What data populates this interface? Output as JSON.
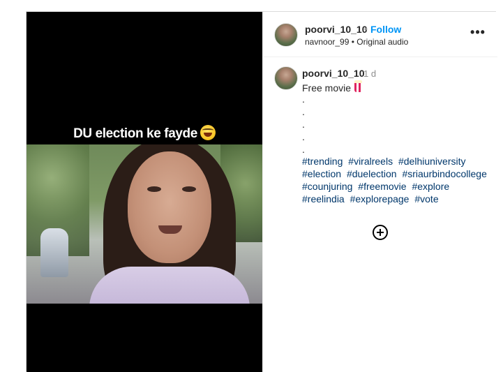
{
  "media": {
    "overlay_text": "DU election ke fayde"
  },
  "header": {
    "username": "poorvi_10_10",
    "separator": "•",
    "follow_label": "Follow",
    "audio_line": "navnoor_99 • Original audio",
    "more_label": "•••"
  },
  "caption": {
    "username": "poorvi_10_10",
    "time": "1 d",
    "text": "Free movie",
    "dots": [
      ".",
      ".",
      ".",
      ".",
      "."
    ],
    "hashtags": [
      "#trending",
      "#viralreels",
      "#delhiuniversity",
      "#election",
      "#duelection",
      "#sriaurbindocollege",
      "#counjuring",
      "#freemovie",
      "#explore",
      "#reelindia",
      "#explorepage",
      "#vote"
    ]
  },
  "icons": {
    "overlay_emoji": "laughing-tears-emoji",
    "caption_emoji": "popcorn-emoji",
    "load_more": "plus-circle-icon",
    "more": "more-horizontal-icon"
  }
}
